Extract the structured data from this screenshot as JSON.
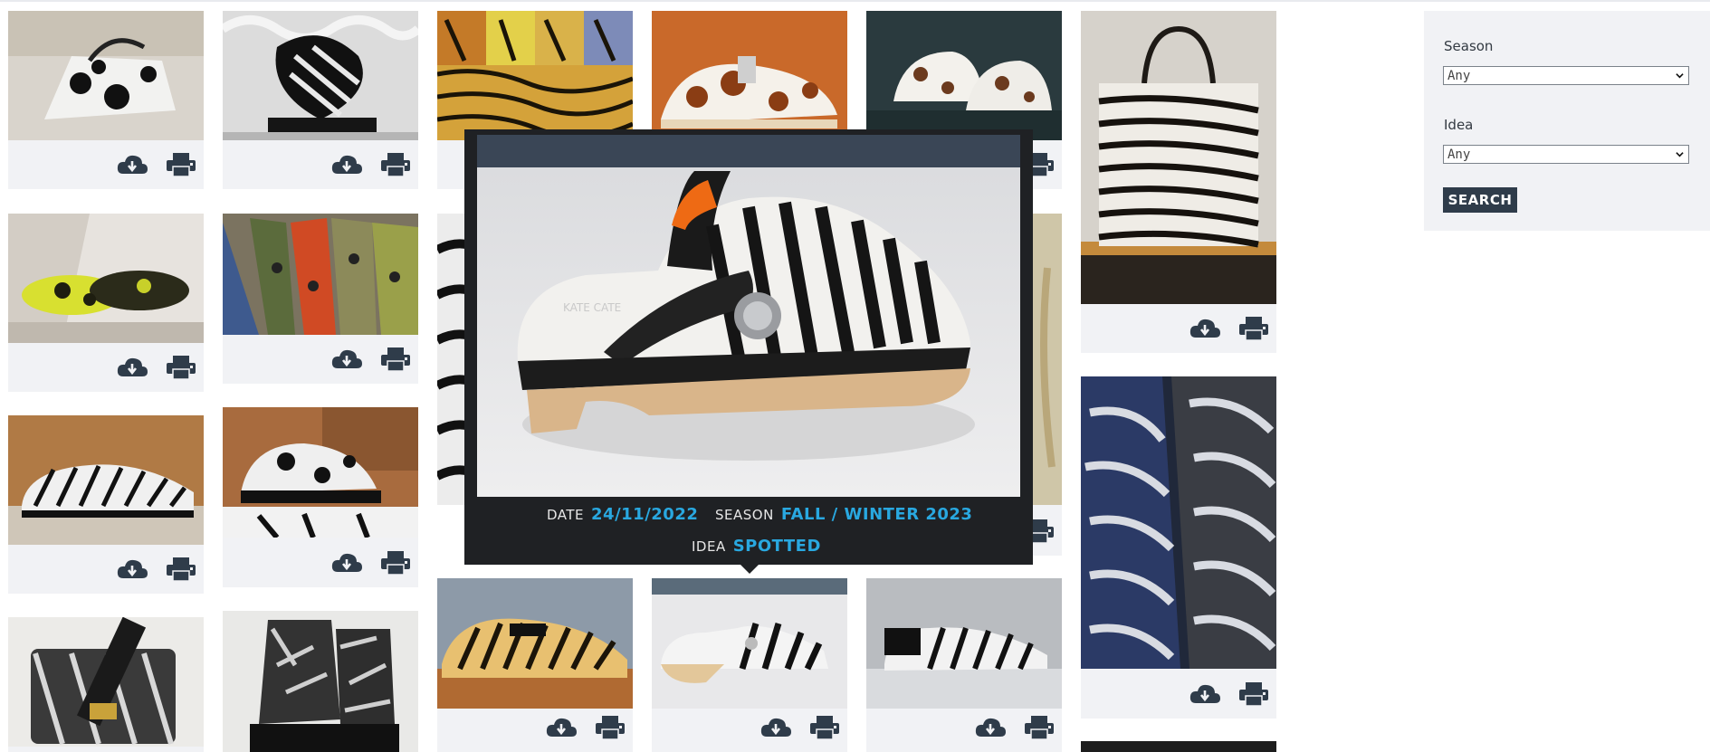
{
  "sidebar": {
    "season_label": "Season",
    "season_value": "Any",
    "idea_label": "Idea",
    "idea_value": "Any",
    "search_label": "SEARCH"
  },
  "popup": {
    "date_label": "DATE",
    "date_value": "24/11/2022",
    "season_label": "SEASON",
    "season_value": "FALL / WINTER 2023",
    "idea_label": "IDEA",
    "idea_value": "SPOTTED",
    "photo_brand_text": "KATE CATE"
  },
  "icons": {
    "download": "cloud-download-icon",
    "print": "print-icon"
  },
  "colors": {
    "accent": "#29a8e0",
    "icon": "#2f3c4a",
    "card_bg": "#f1f2f5",
    "popup_bg": "#1f2124",
    "button_bg": "#2f3c4a"
  }
}
